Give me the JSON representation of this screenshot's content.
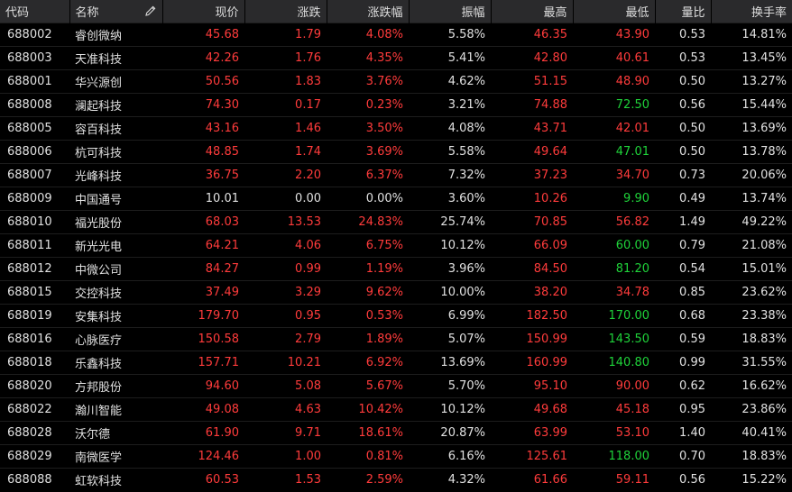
{
  "colors": {
    "up": "#ff3b3b",
    "down": "#1fd33a",
    "flat": "#e0e0e0",
    "header_bg": "#2a2a2c",
    "background": "#000000"
  },
  "header": {
    "code": "代码",
    "name": "名称",
    "price": "现价",
    "change": "涨跌",
    "change_pct": "涨跌幅",
    "amplitude": "振幅",
    "high": "最高",
    "low": "最低",
    "volume_ratio": "量比",
    "turnover": "换手率",
    "edit_icon": "pencil-icon"
  },
  "rows": [
    {
      "code": "688002",
      "name": "睿创微纳",
      "price": "45.68",
      "change": "1.79",
      "change_pct": "4.08%",
      "amplitude": "5.58%",
      "high": "46.35",
      "low": "43.90",
      "volume_ratio": "0.53",
      "turnover": "14.81%",
      "price_c": "up",
      "change_c": "up",
      "pct_c": "up",
      "high_c": "up",
      "low_c": "up"
    },
    {
      "code": "688003",
      "name": "天准科技",
      "price": "42.26",
      "change": "1.76",
      "change_pct": "4.35%",
      "amplitude": "5.41%",
      "high": "42.80",
      "low": "40.61",
      "volume_ratio": "0.53",
      "turnover": "13.45%",
      "price_c": "up",
      "change_c": "up",
      "pct_c": "up",
      "high_c": "up",
      "low_c": "up"
    },
    {
      "code": "688001",
      "name": "华兴源创",
      "price": "50.56",
      "change": "1.83",
      "change_pct": "3.76%",
      "amplitude": "4.62%",
      "high": "51.15",
      "low": "48.90",
      "volume_ratio": "0.50",
      "turnover": "13.27%",
      "price_c": "up",
      "change_c": "up",
      "pct_c": "up",
      "high_c": "up",
      "low_c": "up"
    },
    {
      "code": "688008",
      "name": "澜起科技",
      "price": "74.30",
      "change": "0.17",
      "change_pct": "0.23%",
      "amplitude": "3.21%",
      "high": "74.88",
      "low": "72.50",
      "volume_ratio": "0.56",
      "turnover": "15.44%",
      "price_c": "up",
      "change_c": "up",
      "pct_c": "up",
      "high_c": "up",
      "low_c": "down"
    },
    {
      "code": "688005",
      "name": "容百科技",
      "price": "43.16",
      "change": "1.46",
      "change_pct": "3.50%",
      "amplitude": "4.08%",
      "high": "43.71",
      "low": "42.01",
      "volume_ratio": "0.50",
      "turnover": "13.69%",
      "price_c": "up",
      "change_c": "up",
      "pct_c": "up",
      "high_c": "up",
      "low_c": "up"
    },
    {
      "code": "688006",
      "name": "杭可科技",
      "price": "48.85",
      "change": "1.74",
      "change_pct": "3.69%",
      "amplitude": "5.58%",
      "high": "49.64",
      "low": "47.01",
      "volume_ratio": "0.50",
      "turnover": "13.78%",
      "price_c": "up",
      "change_c": "up",
      "pct_c": "up",
      "high_c": "up",
      "low_c": "down"
    },
    {
      "code": "688007",
      "name": "光峰科技",
      "price": "36.75",
      "change": "2.20",
      "change_pct": "6.37%",
      "amplitude": "7.32%",
      "high": "37.23",
      "low": "34.70",
      "volume_ratio": "0.73",
      "turnover": "20.06%",
      "price_c": "up",
      "change_c": "up",
      "pct_c": "up",
      "high_c": "up",
      "low_c": "up"
    },
    {
      "code": "688009",
      "name": "中国通号",
      "price": "10.01",
      "change": "0.00",
      "change_pct": "0.00%",
      "amplitude": "3.60%",
      "high": "10.26",
      "low": "9.90",
      "volume_ratio": "0.49",
      "turnover": "13.74%",
      "price_c": "flat",
      "change_c": "flat",
      "pct_c": "flat",
      "high_c": "up",
      "low_c": "down"
    },
    {
      "code": "688010",
      "name": "福光股份",
      "price": "68.03",
      "change": "13.53",
      "change_pct": "24.83%",
      "amplitude": "25.74%",
      "high": "70.85",
      "low": "56.82",
      "volume_ratio": "1.49",
      "turnover": "49.22%",
      "price_c": "up",
      "change_c": "up",
      "pct_c": "up",
      "high_c": "up",
      "low_c": "up"
    },
    {
      "code": "688011",
      "name": "新光光电",
      "price": "64.21",
      "change": "4.06",
      "change_pct": "6.75%",
      "amplitude": "10.12%",
      "high": "66.09",
      "low": "60.00",
      "volume_ratio": "0.79",
      "turnover": "21.08%",
      "price_c": "up",
      "change_c": "up",
      "pct_c": "up",
      "high_c": "up",
      "low_c": "down"
    },
    {
      "code": "688012",
      "name": "中微公司",
      "price": "84.27",
      "change": "0.99",
      "change_pct": "1.19%",
      "amplitude": "3.96%",
      "high": "84.50",
      "low": "81.20",
      "volume_ratio": "0.54",
      "turnover": "15.01%",
      "price_c": "up",
      "change_c": "up",
      "pct_c": "up",
      "high_c": "up",
      "low_c": "down"
    },
    {
      "code": "688015",
      "name": "交控科技",
      "price": "37.49",
      "change": "3.29",
      "change_pct": "9.62%",
      "amplitude": "10.00%",
      "high": "38.20",
      "low": "34.78",
      "volume_ratio": "0.85",
      "turnover": "23.62%",
      "price_c": "up",
      "change_c": "up",
      "pct_c": "up",
      "high_c": "up",
      "low_c": "up"
    },
    {
      "code": "688019",
      "name": "安集科技",
      "price": "179.70",
      "change": "0.95",
      "change_pct": "0.53%",
      "amplitude": "6.99%",
      "high": "182.50",
      "low": "170.00",
      "volume_ratio": "0.68",
      "turnover": "23.38%",
      "price_c": "up",
      "change_c": "up",
      "pct_c": "up",
      "high_c": "up",
      "low_c": "down"
    },
    {
      "code": "688016",
      "name": "心脉医疗",
      "price": "150.58",
      "change": "2.79",
      "change_pct": "1.89%",
      "amplitude": "5.07%",
      "high": "150.99",
      "low": "143.50",
      "volume_ratio": "0.59",
      "turnover": "18.83%",
      "price_c": "up",
      "change_c": "up",
      "pct_c": "up",
      "high_c": "up",
      "low_c": "down"
    },
    {
      "code": "688018",
      "name": "乐鑫科技",
      "price": "157.71",
      "change": "10.21",
      "change_pct": "6.92%",
      "amplitude": "13.69%",
      "high": "160.99",
      "low": "140.80",
      "volume_ratio": "0.99",
      "turnover": "31.55%",
      "price_c": "up",
      "change_c": "up",
      "pct_c": "up",
      "high_c": "up",
      "low_c": "down"
    },
    {
      "code": "688020",
      "name": "方邦股份",
      "price": "94.60",
      "change": "5.08",
      "change_pct": "5.67%",
      "amplitude": "5.70%",
      "high": "95.10",
      "low": "90.00",
      "volume_ratio": "0.62",
      "turnover": "16.62%",
      "price_c": "up",
      "change_c": "up",
      "pct_c": "up",
      "high_c": "up",
      "low_c": "up"
    },
    {
      "code": "688022",
      "name": "瀚川智能",
      "price": "49.08",
      "change": "4.63",
      "change_pct": "10.42%",
      "amplitude": "10.12%",
      "high": "49.68",
      "low": "45.18",
      "volume_ratio": "0.95",
      "turnover": "23.86%",
      "price_c": "up",
      "change_c": "up",
      "pct_c": "up",
      "high_c": "up",
      "low_c": "up"
    },
    {
      "code": "688028",
      "name": "沃尔德",
      "price": "61.90",
      "change": "9.71",
      "change_pct": "18.61%",
      "amplitude": "20.87%",
      "high": "63.99",
      "low": "53.10",
      "volume_ratio": "1.40",
      "turnover": "40.41%",
      "price_c": "up",
      "change_c": "up",
      "pct_c": "up",
      "high_c": "up",
      "low_c": "up"
    },
    {
      "code": "688029",
      "name": "南微医学",
      "price": "124.46",
      "change": "1.00",
      "change_pct": "0.81%",
      "amplitude": "6.16%",
      "high": "125.61",
      "low": "118.00",
      "volume_ratio": "0.70",
      "turnover": "18.83%",
      "price_c": "up",
      "change_c": "up",
      "pct_c": "up",
      "high_c": "up",
      "low_c": "down"
    },
    {
      "code": "688088",
      "name": "虹软科技",
      "price": "60.53",
      "change": "1.53",
      "change_pct": "2.59%",
      "amplitude": "4.32%",
      "high": "61.66",
      "low": "59.11",
      "volume_ratio": "0.56",
      "turnover": "15.22%",
      "price_c": "up",
      "change_c": "up",
      "pct_c": "up",
      "high_c": "up",
      "low_c": "up"
    }
  ]
}
